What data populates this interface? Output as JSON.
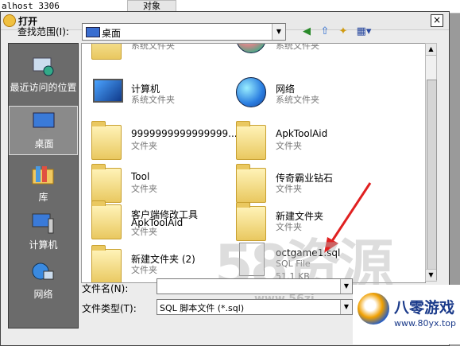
{
  "background_window": {
    "host_text": "alhost 3306",
    "tab_label": "对象"
  },
  "dialog": {
    "title": "打开",
    "close_glyph": "×"
  },
  "toolbar": {
    "look_in_label": "查找范围(I):",
    "look_in_value": "桌面",
    "back_glyph": "◀",
    "up_glyph": "⇧",
    "new_folder_glyph": "✦",
    "view_glyph": "▦▾"
  },
  "places": [
    {
      "label": "最近访问的位置",
      "icon": "recent-places-icon"
    },
    {
      "label": "桌面",
      "icon": "desktop-icon"
    },
    {
      "label": "库",
      "icon": "libraries-icon"
    },
    {
      "label": "计算机",
      "icon": "computer-icon"
    },
    {
      "label": "网络",
      "icon": "network-icon"
    }
  ],
  "files": [
    {
      "name": "",
      "type": "系统文件夹",
      "icon": "user-folder-icon"
    },
    {
      "name": "",
      "type": "系统文件夹",
      "icon": "user-icon"
    },
    {
      "name": "计算机",
      "type": "系统文件夹",
      "icon": "computer-icon"
    },
    {
      "name": "网络",
      "type": "系统文件夹",
      "icon": "network-icon"
    },
    {
      "name": "9999999999999999...",
      "type": "文件夹",
      "icon": "folder-icon"
    },
    {
      "name": "ApkToolAid",
      "type": "文件夹",
      "icon": "folder-icon"
    },
    {
      "name": "Tool",
      "type": "文件夹",
      "icon": "folder-icon"
    },
    {
      "name": "传奇霸业钻石",
      "type": "文件夹",
      "icon": "folder-icon"
    },
    {
      "name": "客户端修改工具",
      "name2": "ApkToolAid",
      "type": "文件夹",
      "icon": "folder-icon"
    },
    {
      "name": "新建文件夹",
      "type": "文件夹",
      "icon": "folder-icon"
    },
    {
      "name": "新建文件夹 (2)",
      "type": "文件夹",
      "icon": "folder-icon"
    },
    {
      "name": "octgame1.sql",
      "type": "SQL File",
      "size": "51.1 KB",
      "icon": "sql-file-icon"
    }
  ],
  "bottom": {
    "filename_label": "文件名(N):",
    "filename_value": "",
    "filetype_label": "文件类型(T):",
    "filetype_value": "SQL 脚本文件 (*.sql)"
  },
  "watermark": {
    "big": "58资源",
    "url": "www.56zi",
    "logo_name": "八零游戏",
    "logo_url": "www.80yx.top"
  },
  "colors": {
    "places_bg": "#6b6b6b",
    "arrow": "#e02020",
    "logo_text": "#1a3a8a"
  }
}
